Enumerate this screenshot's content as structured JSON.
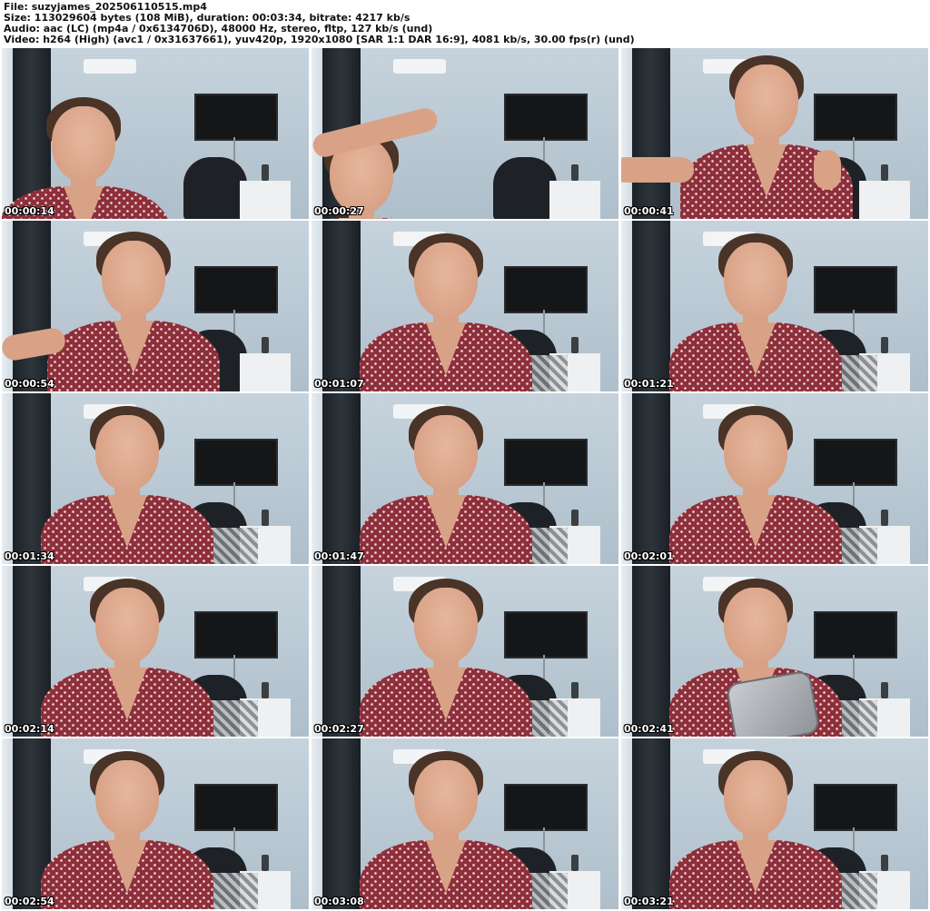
{
  "header": {
    "file_line": "File: suzyjames_202506110515.mp4",
    "size_line": "Size: 113029604 bytes (108 MiB), duration: 00:03:34, bitrate: 4217 kb/s",
    "audio_line": "Audio: aac (LC) (mp4a / 0x6134706D), 48000 Hz, stereo, fltp, 127 kb/s (und)",
    "video_line": "Video: h264 (High) (avc1 / 0x31637661), yuv420p, 1920x1080 [SAR 1:1 DAR 16:9], 4081 kb/s, 30.00 fps(r) (und)"
  },
  "frames": [
    {
      "timestamp": "00:00:14",
      "pose": "tilted-left"
    },
    {
      "timestamp": "00:00:27",
      "pose": "arm-raised"
    },
    {
      "timestamp": "00:00:41",
      "pose": "arm-extended"
    },
    {
      "timestamp": "00:00:54",
      "pose": "arm-left"
    },
    {
      "timestamp": "00:01:07",
      "pose": "centered"
    },
    {
      "timestamp": "00:01:21",
      "pose": "centered"
    },
    {
      "timestamp": "00:01:34",
      "pose": "centered-left"
    },
    {
      "timestamp": "00:01:47",
      "pose": "centered"
    },
    {
      "timestamp": "00:02:01",
      "pose": "centered"
    },
    {
      "timestamp": "00:02:14",
      "pose": "centered-left"
    },
    {
      "timestamp": "00:02:27",
      "pose": "centered"
    },
    {
      "timestamp": "00:02:41",
      "pose": "holding-phone"
    },
    {
      "timestamp": "00:02:54",
      "pose": "centered-left"
    },
    {
      "timestamp": "00:03:08",
      "pose": "centered"
    },
    {
      "timestamp": "00:03:21",
      "pose": "centered"
    }
  ]
}
